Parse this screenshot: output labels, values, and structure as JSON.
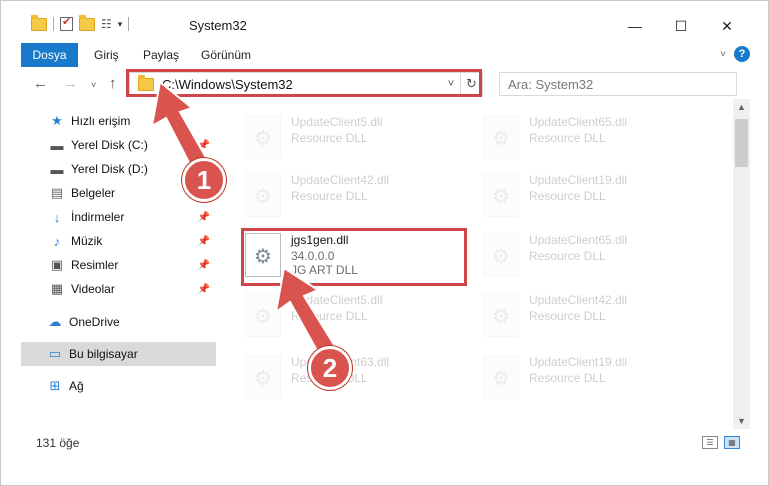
{
  "window": {
    "title": "System32"
  },
  "ribbon": {
    "tabs": [
      "Dosya",
      "Giriş",
      "Paylaş",
      "Görünüm"
    ]
  },
  "navbar": {
    "address": "C:\\Windows\\System32",
    "search_placeholder": "Ara: System32"
  },
  "sidebar": {
    "items": [
      {
        "label": "Hızlı erişim",
        "icon": "star-icon",
        "pinned": false
      },
      {
        "label": "Yerel Disk (C:)",
        "icon": "drive-icon",
        "pinned": true
      },
      {
        "label": "Yerel Disk (D:)",
        "icon": "drive-icon",
        "pinned": false
      },
      {
        "label": "Belgeler",
        "icon": "document-icon",
        "pinned": false
      },
      {
        "label": "İndirmeler",
        "icon": "download-icon",
        "pinned": true
      },
      {
        "label": "Müzik",
        "icon": "music-icon",
        "pinned": true
      },
      {
        "label": "Resimler",
        "icon": "picture-icon",
        "pinned": true
      },
      {
        "label": "Videolar",
        "icon": "video-icon",
        "pinned": true
      },
      {
        "label": "OneDrive",
        "icon": "cloud-icon",
        "pinned": false
      },
      {
        "label": "Bu bilgisayar",
        "icon": "computer-icon",
        "pinned": false,
        "selected": true
      },
      {
        "label": "Ağ",
        "icon": "network-icon",
        "pinned": false
      }
    ]
  },
  "files": [
    {
      "name": "UpdateClient5.dll",
      "type": "Resource DLL"
    },
    {
      "name": "UpdateClient65.dll",
      "type": "Resource DLL"
    },
    {
      "name": "UpdateClient42.dll",
      "type": "Resource DLL"
    },
    {
      "name": "UpdateClient19.dll",
      "type": "Resource DLL"
    },
    {
      "name": "jgs1gen.dll",
      "version": "34.0.0.0",
      "type": "JG ART DLL"
    },
    {
      "name": "UpdateClient65.dll",
      "type": "Resource DLL"
    },
    {
      "name": "UpdateClient5.dll",
      "type": "Resource DLL"
    },
    {
      "name": "UpdateClient42.dll",
      "type": "Resource DLL"
    },
    {
      "name": "UpdateClient63.dll",
      "type": "Resource DLL"
    },
    {
      "name": "UpdateClient19.dll",
      "type": "Resource DLL"
    }
  ],
  "status": {
    "count": "131 öğe"
  },
  "annotations": {
    "step1": "1",
    "step2": "2",
    "color": "#d04545"
  }
}
